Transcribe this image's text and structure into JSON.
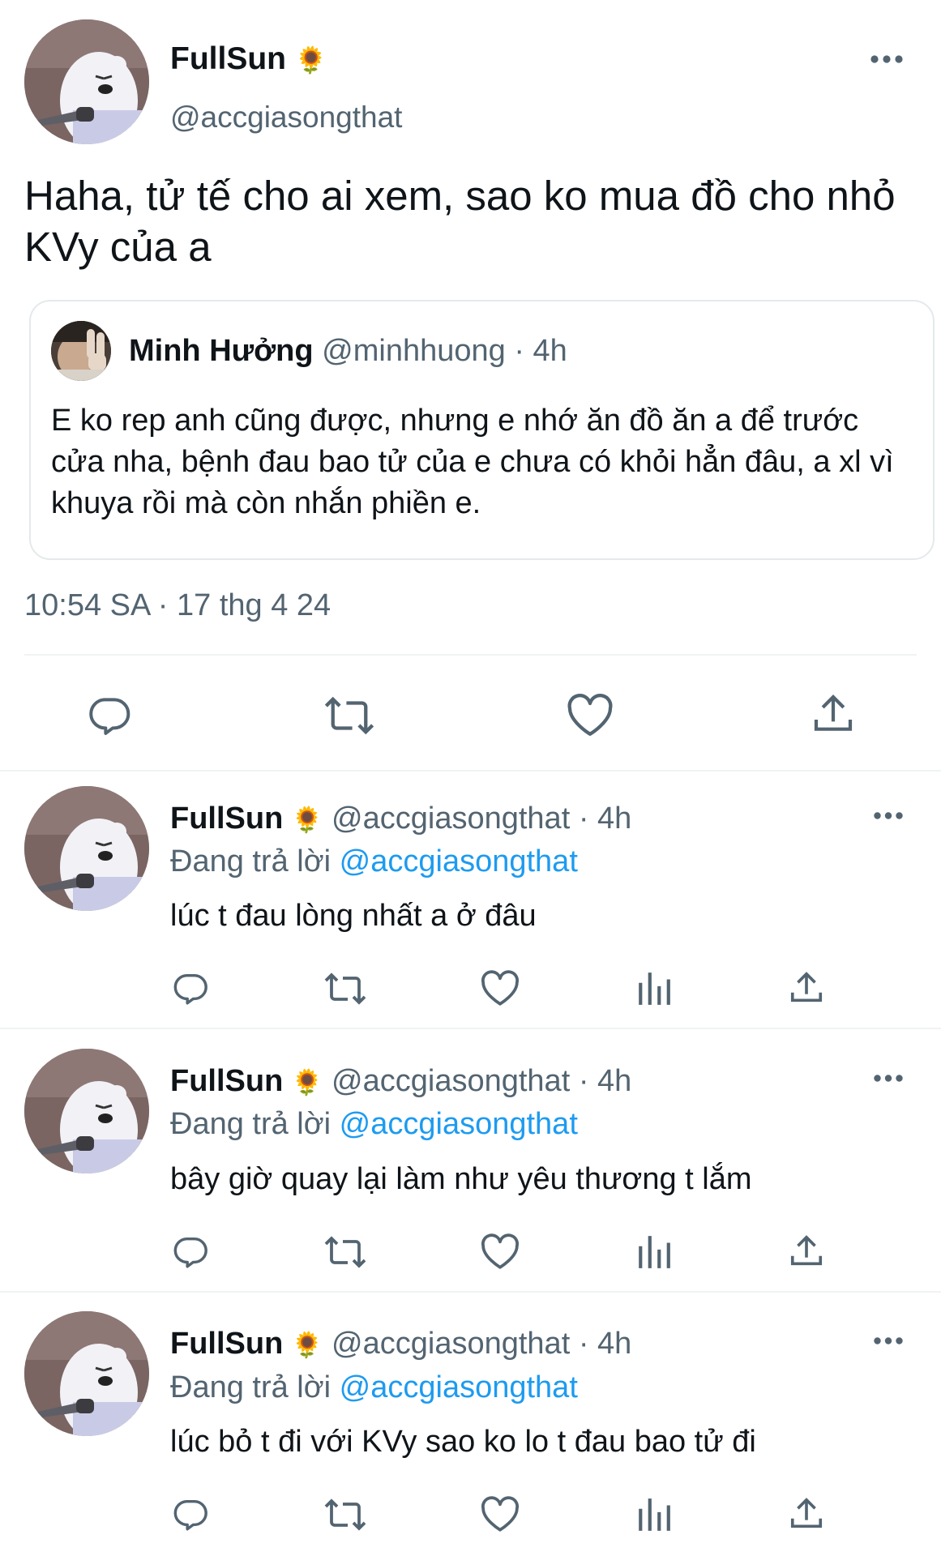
{
  "main_tweet": {
    "name": "FullSun",
    "name_emoji": "🌻",
    "handle": "@accgiasongthat",
    "text": "Haha, tử tế cho ai xem, sao ko mua đồ cho nhỏ KVy của a",
    "timestamp": "10:54 SA · 17 thg 4 24",
    "quote": {
      "name": "Minh Hưởng",
      "handle": "@minhhuong",
      "time": "· 4h",
      "text": "E ko rep anh cũng được, nhưng e nhớ ăn đồ ăn a để trước cửa nha, bệnh đau bao tử của e chưa có khỏi hẳn đâu, a xl vì khuya rồi mà còn nhắn phiền e."
    },
    "actions": [
      "reply-icon",
      "retweet-icon",
      "like-icon",
      "share-icon"
    ]
  },
  "replies": [
    {
      "name": "FullSun",
      "name_emoji": "🌻",
      "handle": "@accgiasongthat",
      "time": "· 4h",
      "replying_label": "Đang trả lời",
      "replying_to": "@accgiasongthat",
      "text": "lúc t đau lòng nhất a ở đâu"
    },
    {
      "name": "FullSun",
      "name_emoji": "🌻",
      "handle": "@accgiasongthat",
      "time": "· 4h",
      "replying_label": "Đang trả lời",
      "replying_to": "@accgiasongthat",
      "text": "bây giờ quay lại làm như yêu thương t lắm"
    },
    {
      "name": "FullSun",
      "name_emoji": "🌻",
      "handle": "@accgiasongthat",
      "time": "· 4h",
      "replying_label": "Đang trả lời",
      "replying_to": "@accgiasongthat",
      "text": "lúc bỏ t đi với KVy sao ko lo t đau bao tử đi"
    }
  ],
  "colors": {
    "accent": "#1d9bf0",
    "secondary_text": "#536471",
    "divider": "#eff3f4"
  }
}
